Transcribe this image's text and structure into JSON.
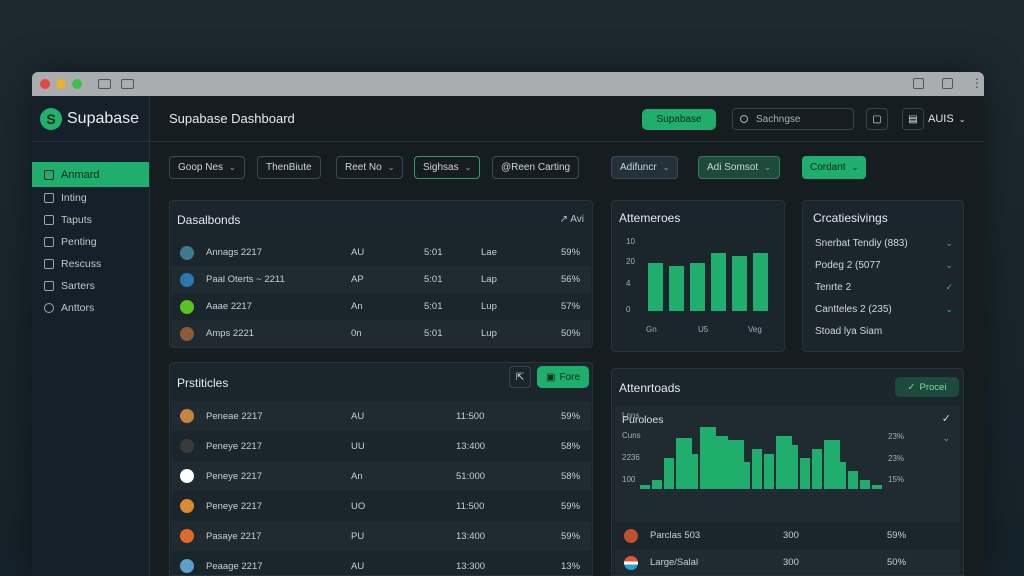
{
  "app": {
    "name": "Supabase",
    "page_title": "Supabase Dashboard",
    "accent": "#1fae6b"
  },
  "header": {
    "primary_button": "Supabase",
    "search_placeholder": "Sachngse",
    "user": "AUIS"
  },
  "sidebar": {
    "active": "Anmard",
    "items": [
      "Inting",
      "Taputs",
      "Penting",
      "Rescuss",
      "Sarters",
      "Anttors"
    ]
  },
  "filters": [
    "Goop Nes",
    "ThenBiute",
    "Reet No",
    "Sighsas",
    "@Reen Carting",
    "Adifuncr",
    "Adi Somsot",
    "Cordant"
  ],
  "dashboards": {
    "title": "Dasalbonds",
    "action": "↗ Avi",
    "rows": [
      [
        "Annags 2217",
        "AU",
        "5:01",
        "Lae",
        "59%"
      ],
      [
        "Paal Oterts ~ 2211",
        "AP",
        "5:01",
        "Lap",
        "56%"
      ],
      [
        "Aaae 2217",
        "An",
        "5:01",
        "Lup",
        "57%"
      ],
      [
        "Amps 2221",
        "0n",
        "5:01",
        "Lup",
        "50%"
      ]
    ]
  },
  "prstiticles": {
    "title": "Prstiticles",
    "button": "Fore",
    "rows": [
      [
        "Peneae 2217",
        "AU",
        "11:500",
        "59%"
      ],
      [
        "Peneye 2217",
        "UU",
        "13:400",
        "58%"
      ],
      [
        "Peneye 2217",
        "An",
        "51:000",
        "58%"
      ],
      [
        "Peneye 2217",
        "UO",
        "11:500",
        "59%"
      ],
      [
        "Pasaye 2217",
        "PU",
        "13:400",
        "59%"
      ],
      [
        "Peaage 2217",
        "AU",
        "13:300",
        "13%"
      ]
    ]
  },
  "attemeroes": {
    "title": "Attemeroes",
    "y_ticks": [
      "10",
      "20",
      "4",
      "0"
    ],
    "x_ticks": [
      "Gn",
      "U5",
      "Veg"
    ]
  },
  "chart_data": [
    {
      "type": "bar",
      "title": "Attemeroes",
      "categories": [
        "Gn",
        "",
        "",
        "U5",
        "",
        "Veg"
      ],
      "values": [
        48,
        45,
        48,
        58,
        55,
        58
      ],
      "ylim": [
        0,
        70
      ]
    },
    {
      "type": "bar",
      "title": "Attenrtoads",
      "subtitle": "Puroloes",
      "values": [
        5,
        10,
        35,
        58,
        40,
        70,
        60,
        55,
        30,
        45,
        40,
        60,
        50,
        35,
        45,
        55,
        30,
        20,
        10,
        5
      ],
      "y_ticks_left": [
        "Lnns",
        "Cuns",
        "2236",
        "100"
      ],
      "y_ticks_right": [
        "23%",
        "23%",
        "15%"
      ]
    }
  ],
  "crcatiesivings": {
    "title": "Crcatiesivings",
    "items": [
      "Snerbat Tendiy (883)",
      "Podeg 2 (5077",
      "Tenrte 2",
      "Cantteles 2 (235)",
      "Stoad lya Siam"
    ]
  },
  "attenrtoads": {
    "title": "Attenrtoads",
    "button": "Procei",
    "subtitle": "Puroloes",
    "rows": [
      [
        "Parclas 503",
        "300",
        "59%"
      ],
      [
        "Large/Salal",
        "300",
        "50%"
      ]
    ]
  }
}
